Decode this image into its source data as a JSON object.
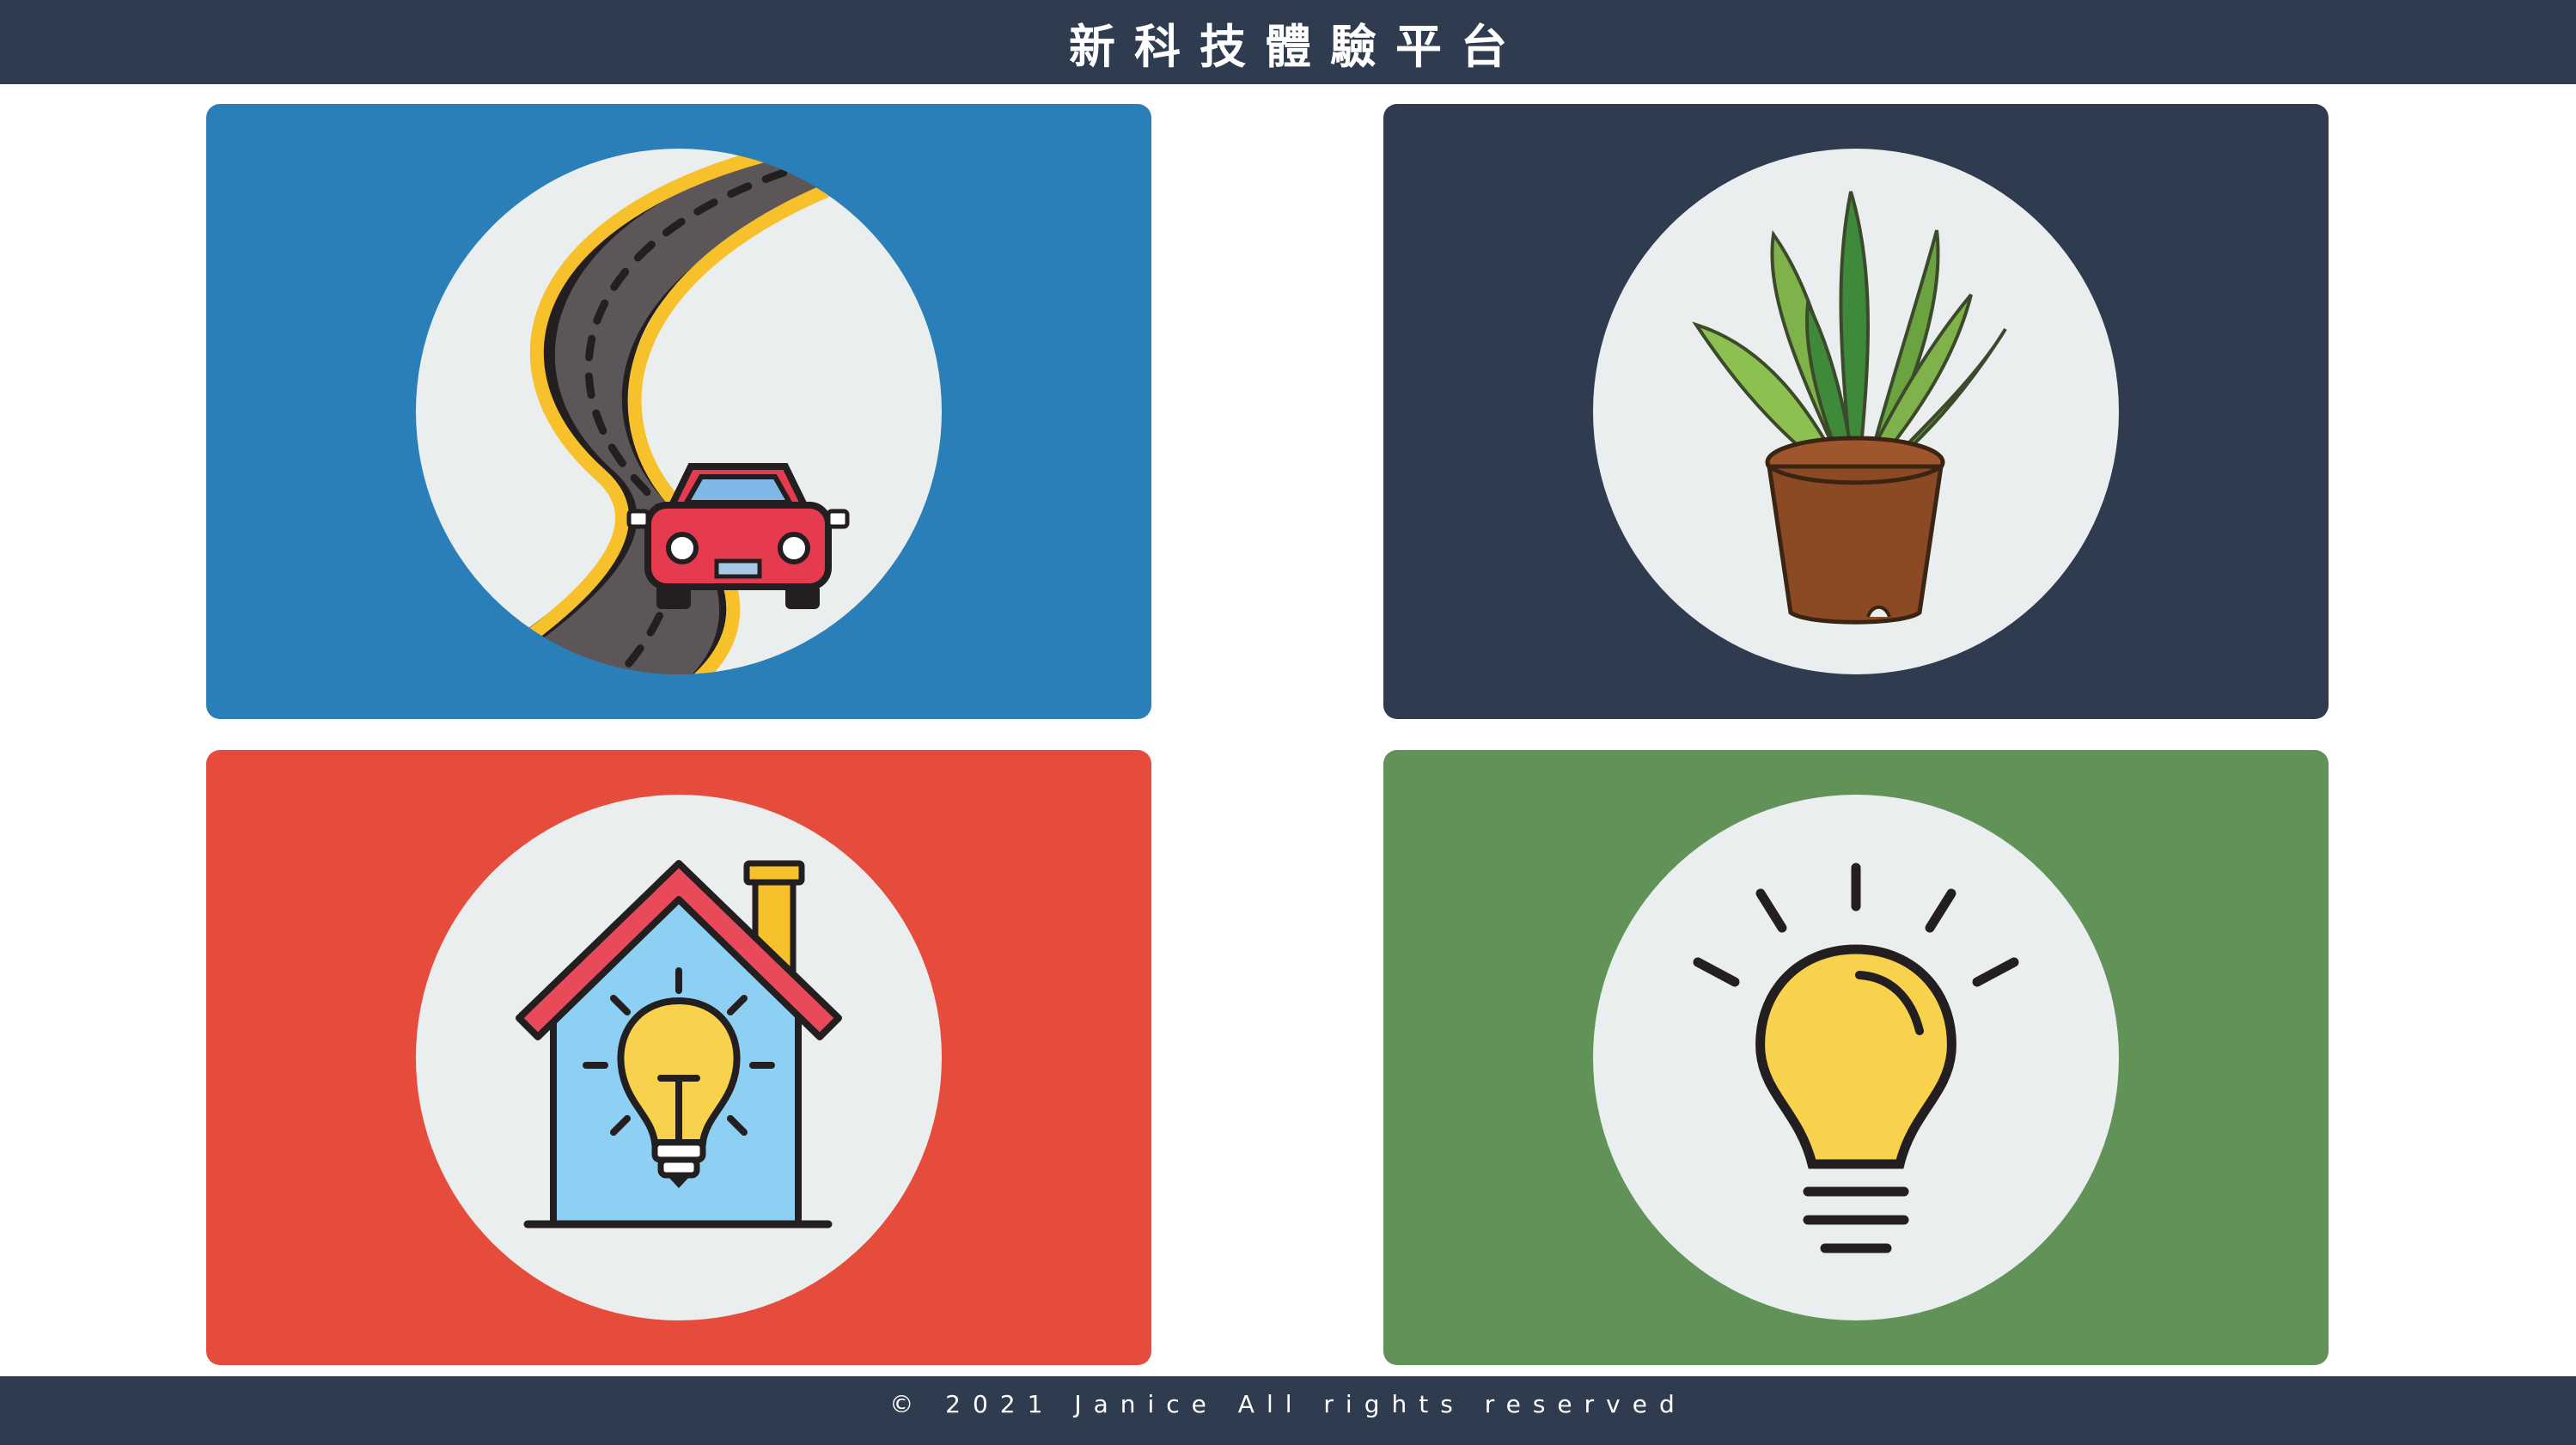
{
  "header": {
    "title": "新科技體驗平台"
  },
  "cards": [
    {
      "icon": "road-car-icon",
      "color": "#2a7fb8"
    },
    {
      "icon": "potted-plant-icon",
      "color": "#2f3c4f"
    },
    {
      "icon": "smart-home-bulb-icon",
      "color": "#e54c3c"
    },
    {
      "icon": "light-bulb-icon",
      "color": "#619359"
    }
  ],
  "footer": {
    "text": "© 2021 Janice All rights reserved"
  },
  "colors": {
    "bar": "#2f3c4f",
    "circle": "#eaeeef"
  }
}
